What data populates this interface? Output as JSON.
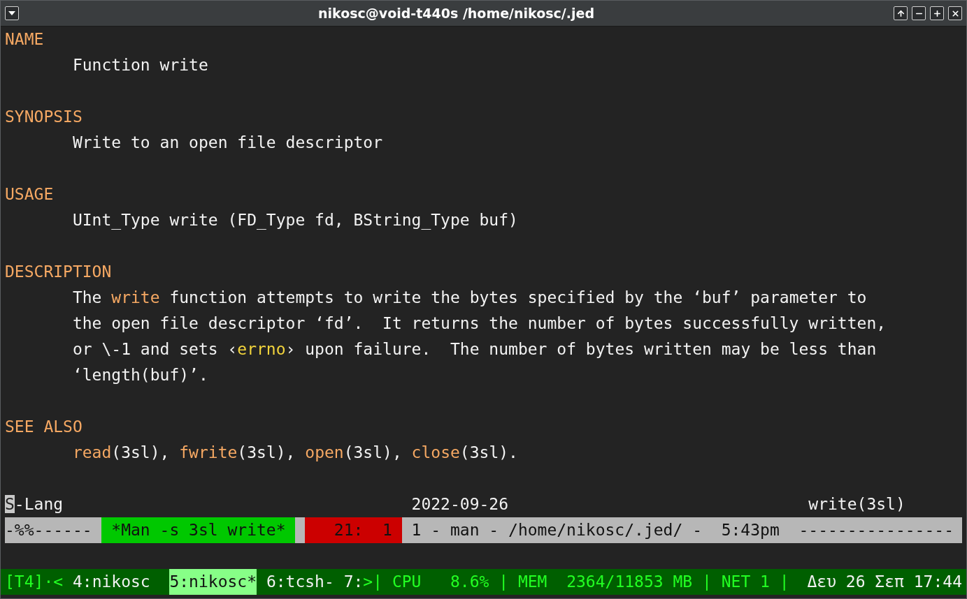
{
  "window": {
    "title": "nikosc@void-t440s /home/nikosc/.jed"
  },
  "sections": [
    {
      "heading": "NAME",
      "lines": [
        [
          {
            "kind": "plain",
            "text": "Function write"
          }
        ]
      ]
    },
    {
      "heading": "SYNOPSIS",
      "lines": [
        [
          {
            "kind": "plain",
            "text": "Write to an open file descriptor"
          }
        ]
      ]
    },
    {
      "heading": "USAGE",
      "lines": [
        [
          {
            "kind": "plain",
            "text": "UInt_Type write (FD_Type fd, BString_Type buf)"
          }
        ]
      ]
    },
    {
      "heading": "DESCRIPTION",
      "lines": [
        [
          {
            "kind": "plain",
            "text": "The "
          },
          {
            "kind": "ref",
            "text": "write"
          },
          {
            "kind": "plain",
            "text": " function attempts to write the bytes specified by the ‘buf’ parameter to"
          }
        ],
        [
          {
            "kind": "plain",
            "text": "the open file descriptor ‘fd’.  It returns the number of bytes successfully written,"
          }
        ],
        [
          {
            "kind": "plain",
            "text": "or \\-1 and sets ‹"
          },
          {
            "kind": "var",
            "text": "errno"
          },
          {
            "kind": "plain",
            "text": "› upon failure.  The number of bytes written may be less than"
          }
        ],
        [
          {
            "kind": "plain",
            "text": "‘length(buf)’."
          }
        ]
      ]
    },
    {
      "heading": "SEE ALSO",
      "lines": [
        [
          {
            "kind": "ref",
            "text": "read"
          },
          {
            "kind": "plain",
            "text": "(3sl), "
          },
          {
            "kind": "ref",
            "text": "fwrite"
          },
          {
            "kind": "plain",
            "text": "(3sl), "
          },
          {
            "kind": "ref",
            "text": "open"
          },
          {
            "kind": "plain",
            "text": "(3sl), "
          },
          {
            "kind": "ref",
            "text": "close"
          },
          {
            "kind": "plain",
            "text": "(3sl)."
          }
        ]
      ]
    }
  ],
  "status_line": {
    "cursor_char": "S",
    "mode": "-Lang",
    "date": "2022-09-26",
    "page": "write(3sl)"
  },
  "mode_line": {
    "flags": "-%%------",
    "buffer": "*Man -s 3sl write*",
    "position": "21:  1",
    "info": "1 - man - /home/nikosc/.jed/ -  5:43pm  ----------------"
  },
  "tmux": {
    "session": "[T4]",
    "left_marker": "·<",
    "windows": [
      {
        "label": "4:nikosc",
        "selected": false
      },
      {
        "label": "5:nikosc*",
        "selected": true
      },
      {
        "label": "6:tcsh-",
        "selected": false
      },
      {
        "label": "7:",
        "selected": false
      }
    ],
    "right_marker": ">|",
    "stats": "CPU   8.6% | MEM  2364/11853 MB | NET 1 |",
    "clock": "Δευ 26 Σεπ 17:44"
  }
}
